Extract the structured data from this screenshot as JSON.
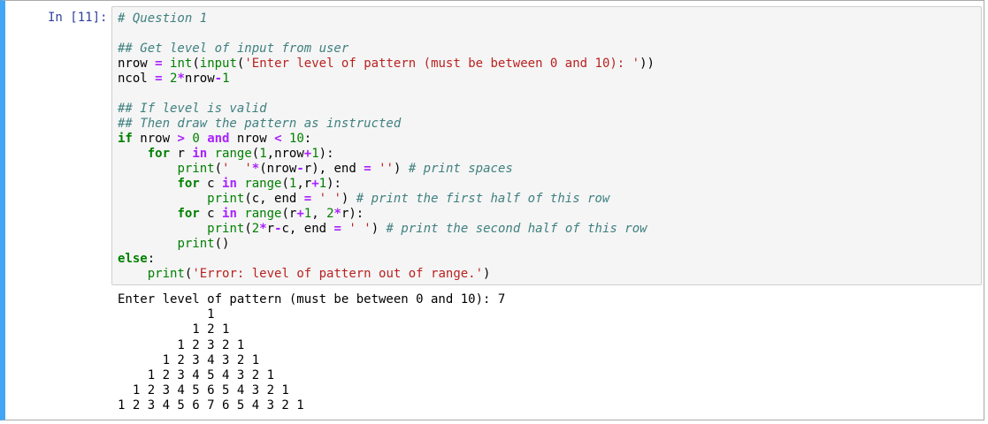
{
  "cell": {
    "prompt": "In [11]:",
    "code_lines": [
      [
        [
          "c",
          "# Question 1"
        ]
      ],
      [],
      [
        [
          "c",
          "## Get level of input from user"
        ]
      ],
      [
        [
          "p",
          "nrow "
        ],
        [
          "o",
          "="
        ],
        [
          "p",
          " "
        ],
        [
          "b",
          "int"
        ],
        [
          "p",
          "("
        ],
        [
          "b",
          "input"
        ],
        [
          "p",
          "("
        ],
        [
          "s",
          "'Enter level of pattern (must be between 0 and 10): '"
        ],
        [
          "p",
          "))"
        ]
      ],
      [
        [
          "p",
          "ncol "
        ],
        [
          "o",
          "="
        ],
        [
          "p",
          " "
        ],
        [
          "n",
          "2"
        ],
        [
          "o",
          "*"
        ],
        [
          "p",
          "nrow"
        ],
        [
          "o",
          "-"
        ],
        [
          "n",
          "1"
        ]
      ],
      [],
      [
        [
          "c",
          "## If level is valid"
        ]
      ],
      [
        [
          "c",
          "## Then draw the pattern as instructed"
        ]
      ],
      [
        [
          "k",
          "if"
        ],
        [
          "p",
          " nrow "
        ],
        [
          "o",
          ">"
        ],
        [
          "p",
          " "
        ],
        [
          "n",
          "0"
        ],
        [
          "p",
          " "
        ],
        [
          "w",
          "and"
        ],
        [
          "p",
          " nrow "
        ],
        [
          "o",
          "<"
        ],
        [
          "p",
          " "
        ],
        [
          "n",
          "10"
        ],
        [
          "p",
          ":"
        ]
      ],
      [
        [
          "p",
          "    "
        ],
        [
          "k",
          "for"
        ],
        [
          "p",
          " r "
        ],
        [
          "w",
          "in"
        ],
        [
          "p",
          " "
        ],
        [
          "b",
          "range"
        ],
        [
          "p",
          "("
        ],
        [
          "n",
          "1"
        ],
        [
          "p",
          ",nrow"
        ],
        [
          "o",
          "+"
        ],
        [
          "n",
          "1"
        ],
        [
          "p",
          "):"
        ]
      ],
      [
        [
          "p",
          "        "
        ],
        [
          "b",
          "print"
        ],
        [
          "p",
          "("
        ],
        [
          "s",
          "'  '"
        ],
        [
          "o",
          "*"
        ],
        [
          "p",
          "(nrow"
        ],
        [
          "o",
          "-"
        ],
        [
          "p",
          "r), end "
        ],
        [
          "o",
          "="
        ],
        [
          "p",
          " "
        ],
        [
          "s",
          "''"
        ],
        [
          "p",
          ") "
        ],
        [
          "c",
          "# print spaces"
        ]
      ],
      [
        [
          "p",
          "        "
        ],
        [
          "k",
          "for"
        ],
        [
          "p",
          " c "
        ],
        [
          "w",
          "in"
        ],
        [
          "p",
          " "
        ],
        [
          "b",
          "range"
        ],
        [
          "p",
          "("
        ],
        [
          "n",
          "1"
        ],
        [
          "p",
          ",r"
        ],
        [
          "o",
          "+"
        ],
        [
          "n",
          "1"
        ],
        [
          "p",
          "):"
        ]
      ],
      [
        [
          "p",
          "            "
        ],
        [
          "b",
          "print"
        ],
        [
          "p",
          "(c, end "
        ],
        [
          "o",
          "="
        ],
        [
          "p",
          " "
        ],
        [
          "s",
          "' '"
        ],
        [
          "p",
          ") "
        ],
        [
          "c",
          "# print the first half of this row"
        ]
      ],
      [
        [
          "p",
          "        "
        ],
        [
          "k",
          "for"
        ],
        [
          "p",
          " c "
        ],
        [
          "w",
          "in"
        ],
        [
          "p",
          " "
        ],
        [
          "b",
          "range"
        ],
        [
          "p",
          "(r"
        ],
        [
          "o",
          "+"
        ],
        [
          "n",
          "1"
        ],
        [
          "p",
          ", "
        ],
        [
          "n",
          "2"
        ],
        [
          "o",
          "*"
        ],
        [
          "p",
          "r):"
        ]
      ],
      [
        [
          "p",
          "            "
        ],
        [
          "b",
          "print"
        ],
        [
          "p",
          "("
        ],
        [
          "n",
          "2"
        ],
        [
          "o",
          "*"
        ],
        [
          "p",
          "r"
        ],
        [
          "o",
          "-"
        ],
        [
          "p",
          "c, end "
        ],
        [
          "o",
          "="
        ],
        [
          "p",
          " "
        ],
        [
          "s",
          "' '"
        ],
        [
          "p",
          ") "
        ],
        [
          "c",
          "# print the second half of this row"
        ]
      ],
      [
        [
          "p",
          "        "
        ],
        [
          "b",
          "print"
        ],
        [
          "p",
          "()"
        ]
      ],
      [
        [
          "k",
          "else"
        ],
        [
          "p",
          ":"
        ]
      ],
      [
        [
          "p",
          "    "
        ],
        [
          "b",
          "print"
        ],
        [
          "p",
          "("
        ],
        [
          "s",
          "'Error: level of pattern out of range.'"
        ],
        [
          "p",
          ")"
        ]
      ]
    ],
    "output_lines": [
      "Enter level of pattern (must be between 0 and 10): 7",
      "            1 ",
      "          1 2 1 ",
      "        1 2 3 2 1 ",
      "      1 2 3 4 3 2 1 ",
      "    1 2 3 4 5 4 3 2 1 ",
      "  1 2 3 4 5 6 5 4 3 2 1 ",
      "1 2 3 4 5 6 7 6 5 4 3 2 1 "
    ]
  }
}
